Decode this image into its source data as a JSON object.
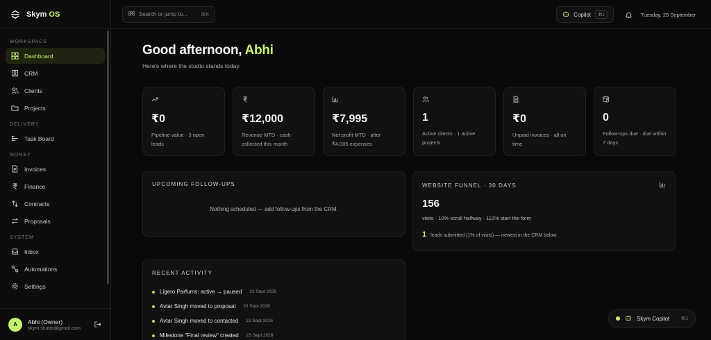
{
  "brand": {
    "name": "Skym",
    "suffix": "OS"
  },
  "sidebar": {
    "sections": [
      {
        "title": "WORKSPACE",
        "items": [
          {
            "label": "Dashboard",
            "icon": "dashboard-icon",
            "active": true
          },
          {
            "label": "CRM",
            "icon": "crm-icon"
          },
          {
            "label": "Clients",
            "icon": "users-icon"
          },
          {
            "label": "Projects",
            "icon": "folder-icon"
          }
        ]
      },
      {
        "title": "DELIVERY",
        "items": [
          {
            "label": "Task Board",
            "icon": "kanban-icon"
          }
        ]
      },
      {
        "title": "MONEY",
        "items": [
          {
            "label": "Invoices",
            "icon": "invoice-icon"
          },
          {
            "label": "Finance",
            "icon": "rupee-icon"
          },
          {
            "label": "Contracts",
            "icon": "contract-icon"
          },
          {
            "label": "Proposals",
            "icon": "proposal-icon"
          }
        ]
      },
      {
        "title": "SYSTEM",
        "items": [
          {
            "label": "Inbox",
            "icon": "inbox-icon"
          },
          {
            "label": "Automations",
            "icon": "automation-icon"
          },
          {
            "label": "Settings",
            "icon": "gear-icon"
          }
        ]
      }
    ],
    "user": {
      "initial": "A",
      "name": "Abhi (Owner)",
      "email": "skym.studio@gmail.com"
    }
  },
  "topbar": {
    "search_placeholder": "Search or jump to...",
    "search_shortcut": "⌘K",
    "copilot_label": "Copilot",
    "copilot_shortcut": "⌘J",
    "date": "Tuesday, 29 September"
  },
  "greeting": {
    "prefix": "Good afternoon, ",
    "name": "Abhi",
    "subtitle": "Here's where the studio stands today."
  },
  "stats": [
    {
      "icon": "trend-icon",
      "value": "₹0",
      "label": "Pipeline value · 3 open leads"
    },
    {
      "icon": "rupee-icon",
      "value": "₹12,000",
      "label": "Revenue MTD · cash collected this month"
    },
    {
      "icon": "bar-chart-icon",
      "value": "₹7,995",
      "label": "Net profit MTD · after ₹4,005 expenses"
    },
    {
      "icon": "users-icon",
      "value": "1",
      "label": "Active clients · 1 active projects"
    },
    {
      "icon": "invoice-icon",
      "value": "₹0",
      "label": "Unpaid invoices · all on time"
    },
    {
      "icon": "calendar-clock-icon",
      "value": "0",
      "label": "Follow-ups due · due within 7 days"
    }
  ],
  "followups": {
    "title": "UPCOMING FOLLOW-UPS",
    "empty": "Nothing scheduled — add follow-ups from the CRM."
  },
  "funnel": {
    "title": "WEBSITE FUNNEL · 30 DAYS",
    "value": "156",
    "desc": "visits · 10% scroll halfway · 112% start the form",
    "leads_count": "1",
    "leads_text": "leads submitted (1% of visits) — newest in the CRM below"
  },
  "activity": {
    "title": "RECENT ACTIVITY",
    "items": [
      {
        "text": "Ligero Parfums: active → paused",
        "date": "23 Sept 2026"
      },
      {
        "text": "Avtar Singh moved to proposal",
        "date": "23 Sept 2026"
      },
      {
        "text": "Avtar Singh moved to contacted",
        "date": "23 Sept 2026"
      },
      {
        "text": "Milestone \"Final review\" created",
        "date": "23 Sept 2026"
      }
    ]
  },
  "floating": {
    "label": "Skym Copilot",
    "shortcut": "⌘J"
  },
  "colors": {
    "accent": "#c6f36e",
    "background": "#0a0a0a",
    "card": "#111111"
  }
}
